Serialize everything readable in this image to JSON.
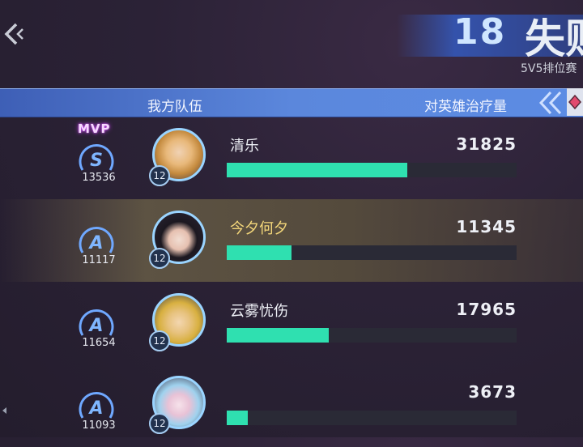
{
  "header": {
    "kill_count": "18",
    "result": "失败",
    "mode": "5V5排位赛"
  },
  "table": {
    "team_label": "我方队伍",
    "stat_label": "对英雄治疗量"
  },
  "colors": {
    "accent_bar": "#2fe0b0",
    "self_name": "#f4d77a",
    "header_bar": "#5b87dc"
  },
  "players": [
    {
      "name": "清乐",
      "heal": "31825",
      "heal_value": 31825,
      "rank": "S",
      "score": "13536",
      "level": "12",
      "mvp": "MVP",
      "is_self": false
    },
    {
      "name": "今夕何夕",
      "heal": "11345",
      "heal_value": 11345,
      "rank": "A",
      "score": "11117",
      "level": "12",
      "is_self": true
    },
    {
      "name": "云雾忧伤",
      "heal": "17965",
      "heal_value": 17965,
      "rank": "A",
      "score": "11654",
      "level": "12",
      "is_self": false
    },
    {
      "name": "",
      "heal": "3673",
      "heal_value": 3673,
      "rank": "A",
      "score": "11093",
      "level": "12",
      "is_self": false
    }
  ],
  "bar_max": 51000
}
